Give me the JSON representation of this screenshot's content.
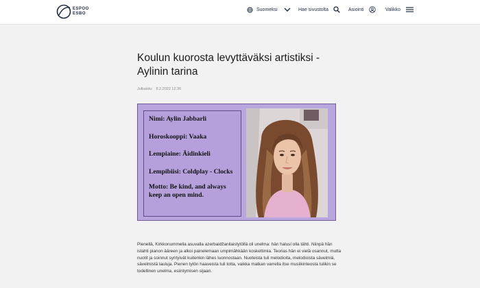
{
  "header": {
    "logo_text_1": "ESPOO",
    "logo_text_2": "ESBO",
    "language_label": "Suomeksi",
    "search_label": "Hae sivustolta",
    "login_label": "Asiointi",
    "menu_label": "Valikko"
  },
  "article": {
    "title": "Koulun kuorosta levyttäväksi artistiksi - Aylinin tarina",
    "published_label": "Julkaistu:",
    "published_date": "8.2.2022 12.36",
    "hero": {
      "name": "Nimi: Aylin Jabbarli",
      "horoscope": "Horoskooppi: Vaaka",
      "favorite_subject": "Lempiaine: Äidinkieli",
      "favorite_song": "Lempibiisi: Coldplay - Clocks",
      "motto": "Motto: Be kind, and always keep an open mind."
    },
    "paragraphs": [
      "Pienellä, Kirkkonummella asuvalla azerbaidžanilaistytöllä oli unelma: hän halusi olla tähti. Niinpä hän istahti pianon ääreen ja alkoi painelemaan umpimähkään koskettimia. Teorias hän ei vielä osannut, mutta nuotit ja soinnut syntyivät kuitenkin lähes luonnostaan. Nuoteista tuli melodioita, melodioista sävelmiä, sävelmistä lauluja. Pienen tytön haaveista tuli totta, vaikka matkan varrella itse musiikinteosta tulikin se todellinen unelma, esiintymisen sijaan."
    ]
  },
  "colors": {
    "hero_background": "#b9a6de",
    "hero_border": "#6d5a98",
    "brand_navy": "#1f2a44"
  },
  "icons": {
    "logo": "espoo-logo-icon",
    "language": "globe-icon",
    "language_toggle": "chevron-down-icon",
    "search": "search-icon",
    "login": "user-icon",
    "menu": "hamburger-menu-icon"
  }
}
